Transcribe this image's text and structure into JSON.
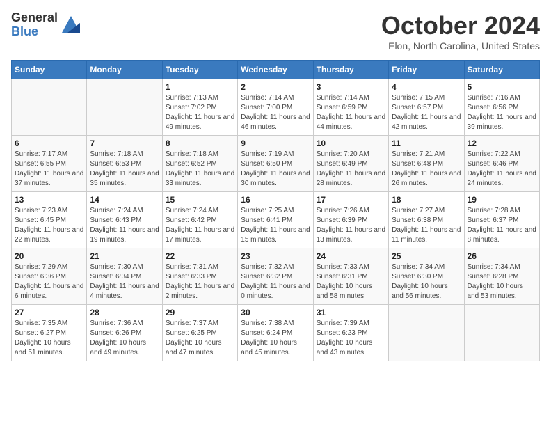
{
  "logo": {
    "general": "General",
    "blue": "Blue"
  },
  "title": "October 2024",
  "location": "Elon, North Carolina, United States",
  "weekdays": [
    "Sunday",
    "Monday",
    "Tuesday",
    "Wednesday",
    "Thursday",
    "Friday",
    "Saturday"
  ],
  "weeks": [
    [
      {
        "day": "",
        "empty": true
      },
      {
        "day": "",
        "empty": true
      },
      {
        "day": "1",
        "sunrise": "Sunrise: 7:13 AM",
        "sunset": "Sunset: 7:02 PM",
        "daylight": "Daylight: 11 hours and 49 minutes."
      },
      {
        "day": "2",
        "sunrise": "Sunrise: 7:14 AM",
        "sunset": "Sunset: 7:00 PM",
        "daylight": "Daylight: 11 hours and 46 minutes."
      },
      {
        "day": "3",
        "sunrise": "Sunrise: 7:14 AM",
        "sunset": "Sunset: 6:59 PM",
        "daylight": "Daylight: 11 hours and 44 minutes."
      },
      {
        "day": "4",
        "sunrise": "Sunrise: 7:15 AM",
        "sunset": "Sunset: 6:57 PM",
        "daylight": "Daylight: 11 hours and 42 minutes."
      },
      {
        "day": "5",
        "sunrise": "Sunrise: 7:16 AM",
        "sunset": "Sunset: 6:56 PM",
        "daylight": "Daylight: 11 hours and 39 minutes."
      }
    ],
    [
      {
        "day": "6",
        "sunrise": "Sunrise: 7:17 AM",
        "sunset": "Sunset: 6:55 PM",
        "daylight": "Daylight: 11 hours and 37 minutes."
      },
      {
        "day": "7",
        "sunrise": "Sunrise: 7:18 AM",
        "sunset": "Sunset: 6:53 PM",
        "daylight": "Daylight: 11 hours and 35 minutes."
      },
      {
        "day": "8",
        "sunrise": "Sunrise: 7:18 AM",
        "sunset": "Sunset: 6:52 PM",
        "daylight": "Daylight: 11 hours and 33 minutes."
      },
      {
        "day": "9",
        "sunrise": "Sunrise: 7:19 AM",
        "sunset": "Sunset: 6:50 PM",
        "daylight": "Daylight: 11 hours and 30 minutes."
      },
      {
        "day": "10",
        "sunrise": "Sunrise: 7:20 AM",
        "sunset": "Sunset: 6:49 PM",
        "daylight": "Daylight: 11 hours and 28 minutes."
      },
      {
        "day": "11",
        "sunrise": "Sunrise: 7:21 AM",
        "sunset": "Sunset: 6:48 PM",
        "daylight": "Daylight: 11 hours and 26 minutes."
      },
      {
        "day": "12",
        "sunrise": "Sunrise: 7:22 AM",
        "sunset": "Sunset: 6:46 PM",
        "daylight": "Daylight: 11 hours and 24 minutes."
      }
    ],
    [
      {
        "day": "13",
        "sunrise": "Sunrise: 7:23 AM",
        "sunset": "Sunset: 6:45 PM",
        "daylight": "Daylight: 11 hours and 22 minutes."
      },
      {
        "day": "14",
        "sunrise": "Sunrise: 7:24 AM",
        "sunset": "Sunset: 6:43 PM",
        "daylight": "Daylight: 11 hours and 19 minutes."
      },
      {
        "day": "15",
        "sunrise": "Sunrise: 7:24 AM",
        "sunset": "Sunset: 6:42 PM",
        "daylight": "Daylight: 11 hours and 17 minutes."
      },
      {
        "day": "16",
        "sunrise": "Sunrise: 7:25 AM",
        "sunset": "Sunset: 6:41 PM",
        "daylight": "Daylight: 11 hours and 15 minutes."
      },
      {
        "day": "17",
        "sunrise": "Sunrise: 7:26 AM",
        "sunset": "Sunset: 6:39 PM",
        "daylight": "Daylight: 11 hours and 13 minutes."
      },
      {
        "day": "18",
        "sunrise": "Sunrise: 7:27 AM",
        "sunset": "Sunset: 6:38 PM",
        "daylight": "Daylight: 11 hours and 11 minutes."
      },
      {
        "day": "19",
        "sunrise": "Sunrise: 7:28 AM",
        "sunset": "Sunset: 6:37 PM",
        "daylight": "Daylight: 11 hours and 8 minutes."
      }
    ],
    [
      {
        "day": "20",
        "sunrise": "Sunrise: 7:29 AM",
        "sunset": "Sunset: 6:36 PM",
        "daylight": "Daylight: 11 hours and 6 minutes."
      },
      {
        "day": "21",
        "sunrise": "Sunrise: 7:30 AM",
        "sunset": "Sunset: 6:34 PM",
        "daylight": "Daylight: 11 hours and 4 minutes."
      },
      {
        "day": "22",
        "sunrise": "Sunrise: 7:31 AM",
        "sunset": "Sunset: 6:33 PM",
        "daylight": "Daylight: 11 hours and 2 minutes."
      },
      {
        "day": "23",
        "sunrise": "Sunrise: 7:32 AM",
        "sunset": "Sunset: 6:32 PM",
        "daylight": "Daylight: 11 hours and 0 minutes."
      },
      {
        "day": "24",
        "sunrise": "Sunrise: 7:33 AM",
        "sunset": "Sunset: 6:31 PM",
        "daylight": "Daylight: 10 hours and 58 minutes."
      },
      {
        "day": "25",
        "sunrise": "Sunrise: 7:34 AM",
        "sunset": "Sunset: 6:30 PM",
        "daylight": "Daylight: 10 hours and 56 minutes."
      },
      {
        "day": "26",
        "sunrise": "Sunrise: 7:34 AM",
        "sunset": "Sunset: 6:28 PM",
        "daylight": "Daylight: 10 hours and 53 minutes."
      }
    ],
    [
      {
        "day": "27",
        "sunrise": "Sunrise: 7:35 AM",
        "sunset": "Sunset: 6:27 PM",
        "daylight": "Daylight: 10 hours and 51 minutes."
      },
      {
        "day": "28",
        "sunrise": "Sunrise: 7:36 AM",
        "sunset": "Sunset: 6:26 PM",
        "daylight": "Daylight: 10 hours and 49 minutes."
      },
      {
        "day": "29",
        "sunrise": "Sunrise: 7:37 AM",
        "sunset": "Sunset: 6:25 PM",
        "daylight": "Daylight: 10 hours and 47 minutes."
      },
      {
        "day": "30",
        "sunrise": "Sunrise: 7:38 AM",
        "sunset": "Sunset: 6:24 PM",
        "daylight": "Daylight: 10 hours and 45 minutes."
      },
      {
        "day": "31",
        "sunrise": "Sunrise: 7:39 AM",
        "sunset": "Sunset: 6:23 PM",
        "daylight": "Daylight: 10 hours and 43 minutes."
      },
      {
        "day": "",
        "empty": true
      },
      {
        "day": "",
        "empty": true
      }
    ]
  ]
}
